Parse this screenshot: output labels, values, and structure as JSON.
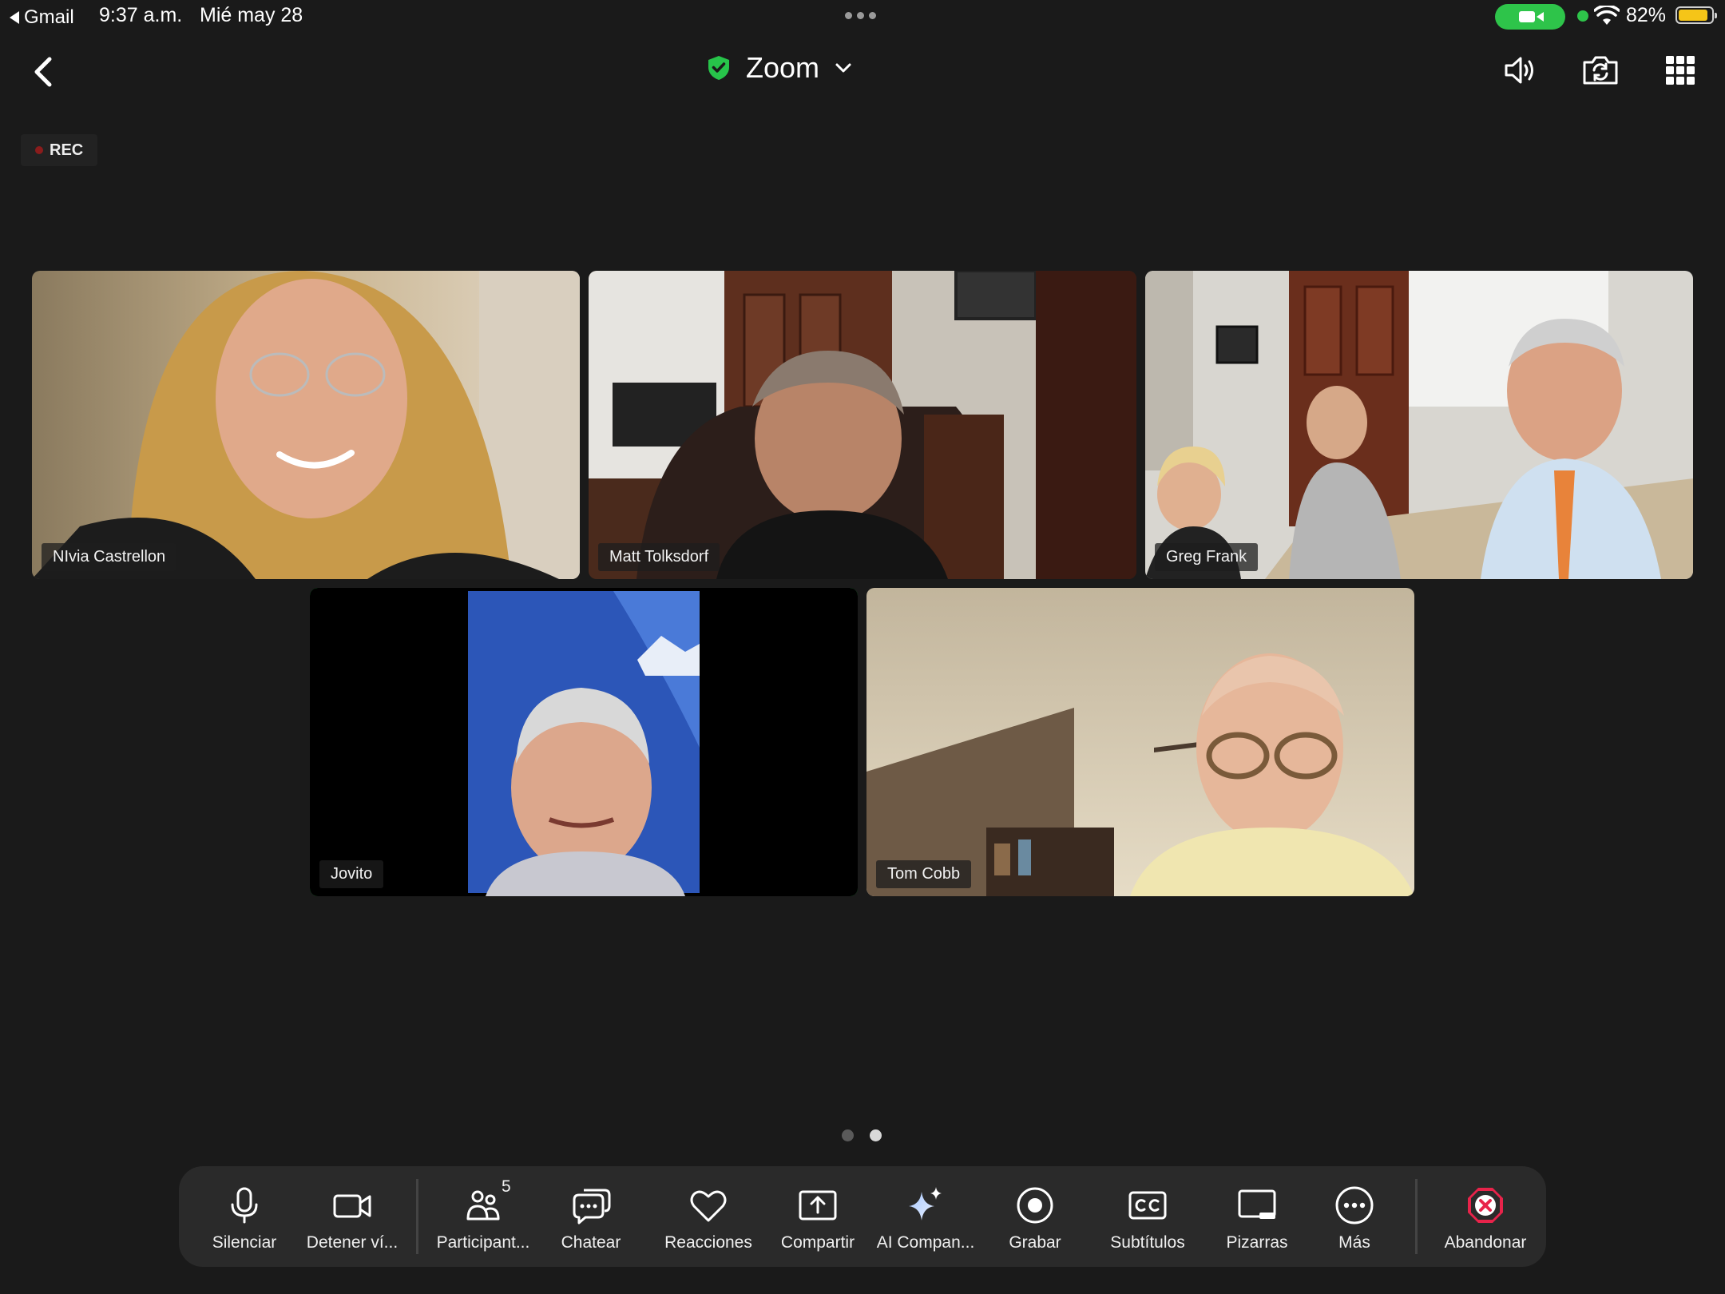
{
  "status_bar": {
    "back_app": "Gmail",
    "time": "9:37 a.m.",
    "date": "Mié may 28",
    "battery_percent": "82%",
    "battery_level": 0.82,
    "camera_indicator_color": "#2ec44a"
  },
  "header": {
    "title": "Zoom",
    "secure_icon": "shield-check-icon",
    "secure_color": "#27c44a",
    "right_icons": [
      "speaker-icon",
      "switch-camera-icon",
      "grid-view-icon"
    ]
  },
  "recording": {
    "label": "REC"
  },
  "participants": [
    {
      "name": "NIvia Castrellon"
    },
    {
      "name": "Matt Tolksdorf"
    },
    {
      "name": "Greg Frank"
    },
    {
      "name": "Jovito",
      "active_speaker": true
    },
    {
      "name": "Tom Cobb"
    }
  ],
  "pagination": {
    "pages": 2,
    "current": 2
  },
  "toolbar": {
    "mute": "Silenciar",
    "stop_video": "Detener ví...",
    "participants": "Participant...",
    "participants_count": "5",
    "chat": "Chatear",
    "reactions": "Reacciones",
    "share": "Compartir",
    "ai_companion": "AI Compan...",
    "record": "Grabar",
    "captions": "Subtítulos",
    "whiteboards": "Pizarras",
    "more": "Más",
    "leave": "Abandonar",
    "leave_color": "#e8234a"
  }
}
